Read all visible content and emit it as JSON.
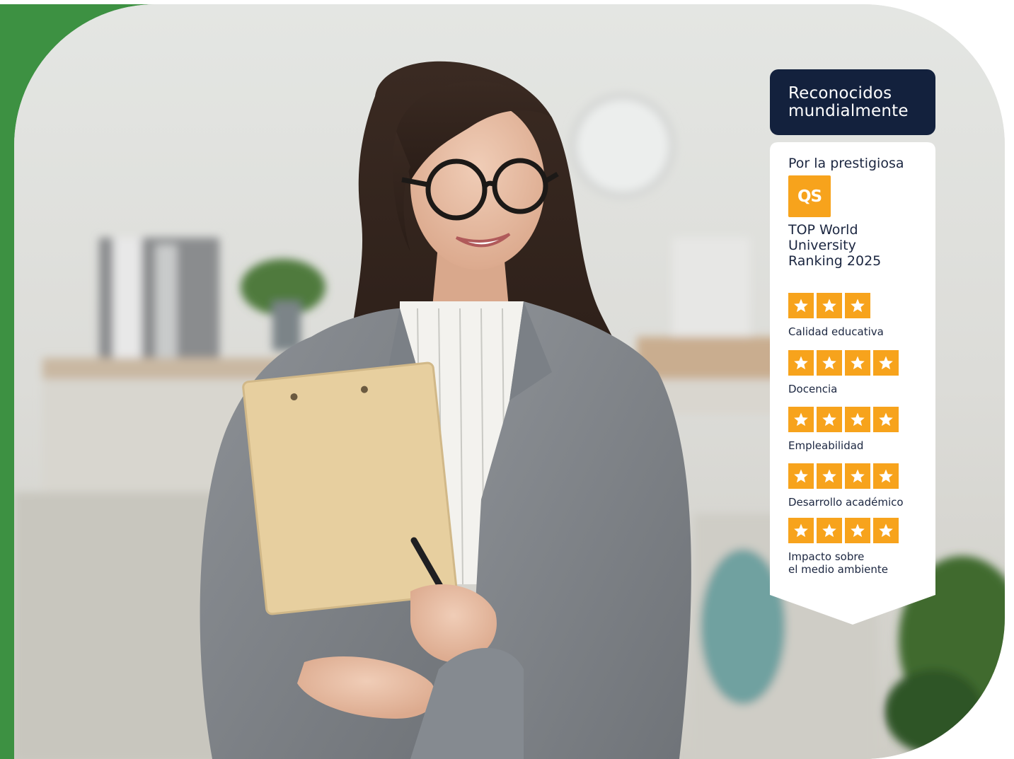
{
  "badge": {
    "header_line1": "Reconocidos",
    "header_line2": "mundialmente",
    "intro": "Por la prestigiosa",
    "logo_text": "QS",
    "ranking_line1": "TOP World",
    "ranking_line2": "University",
    "ranking_line3": "Ranking 2025",
    "criteria": [
      {
        "stars": 3,
        "label_line1": "Calidad educativa",
        "label_line2": ""
      },
      {
        "stars": 4,
        "label_line1": "Docencia",
        "label_line2": ""
      },
      {
        "stars": 4,
        "label_line1": "Empleabilidad",
        "label_line2": ""
      },
      {
        "stars": 4,
        "label_line1": "Desarrollo académico",
        "label_line2": ""
      },
      {
        "stars": 4,
        "label_line1": "Impacto sobre",
        "label_line2": "el medio ambiente"
      }
    ]
  },
  "colors": {
    "green_backdrop": "#3d9142",
    "navy": "#13213d",
    "qs_orange": "#f7a31c",
    "text_dark": "#1b2640"
  },
  "photo": {
    "subject": "smiling-woman-with-clipboard-photo"
  }
}
